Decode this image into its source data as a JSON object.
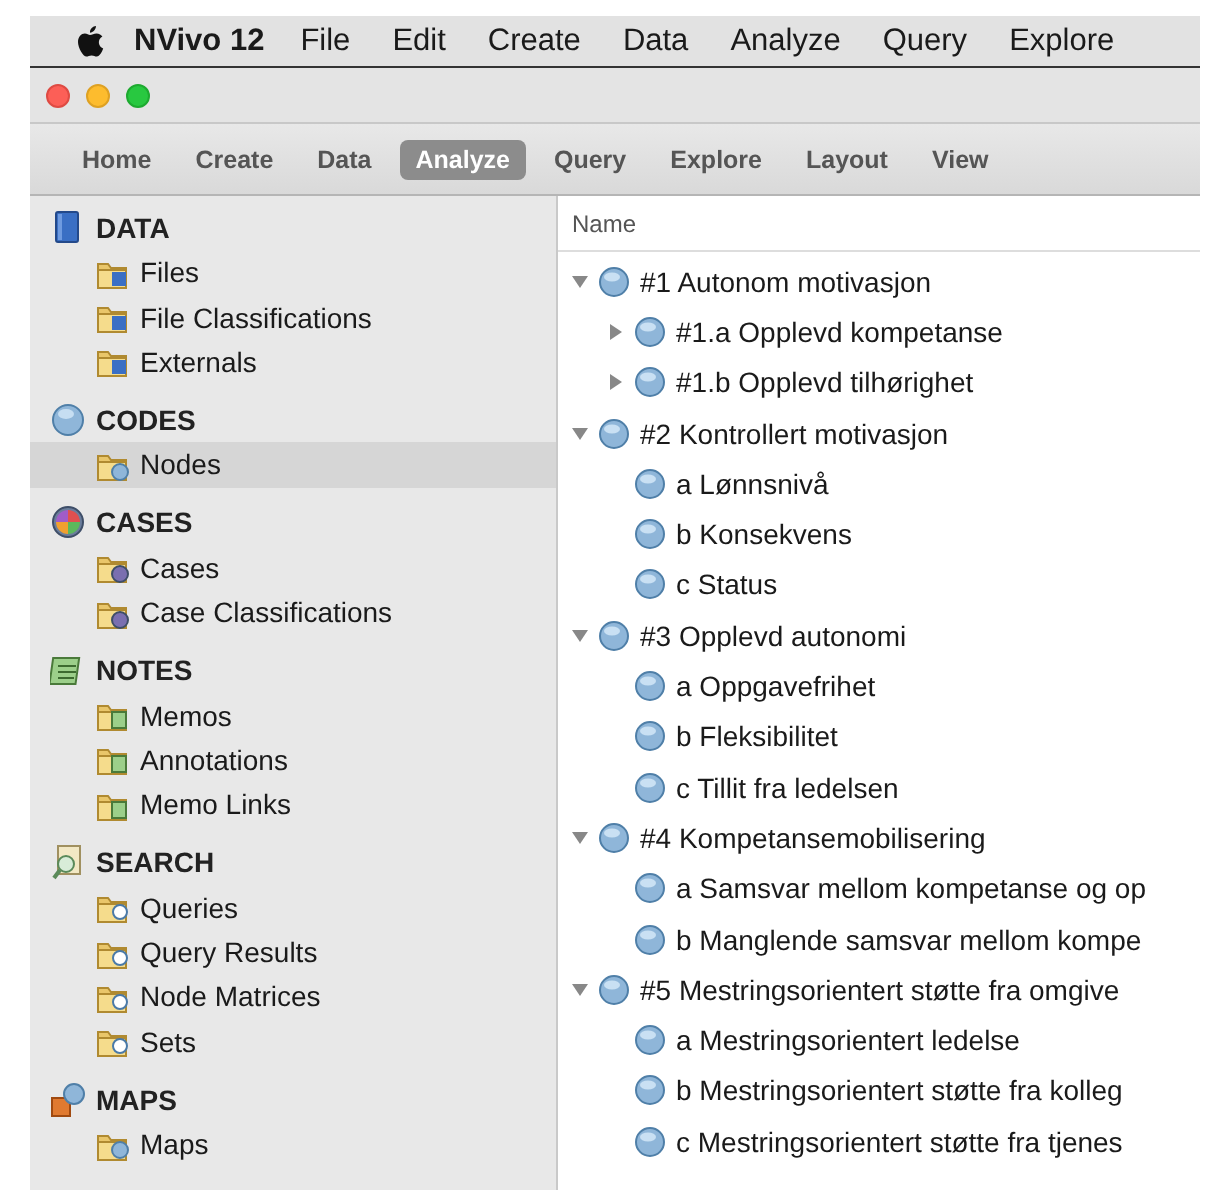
{
  "menu_bar": {
    "app_name": "NVivo 12",
    "menus": [
      "File",
      "Edit",
      "Create",
      "Data",
      "Analyze",
      "Query",
      "Explore"
    ]
  },
  "toolbar": {
    "tabs": [
      {
        "label": "Home",
        "selected": false
      },
      {
        "label": "Create",
        "selected": false
      },
      {
        "label": "Data",
        "selected": false
      },
      {
        "label": "Analyze",
        "selected": true
      },
      {
        "label": "Query",
        "selected": false
      },
      {
        "label": "Explore",
        "selected": false
      },
      {
        "label": "Layout",
        "selected": false
      },
      {
        "label": "View",
        "selected": false
      }
    ]
  },
  "sidebar": {
    "sections": [
      {
        "kind": "data",
        "title": "DATA",
        "items": [
          {
            "label": "Files",
            "selected": false
          },
          {
            "label": "File Classifications",
            "selected": false
          },
          {
            "label": "Externals",
            "selected": false
          }
        ]
      },
      {
        "kind": "codes",
        "title": "CODES",
        "items": [
          {
            "label": "Nodes",
            "selected": true
          }
        ]
      },
      {
        "kind": "cases",
        "title": "CASES",
        "items": [
          {
            "label": "Cases",
            "selected": false
          },
          {
            "label": "Case Classifications",
            "selected": false
          }
        ]
      },
      {
        "kind": "notes",
        "title": "NOTES",
        "items": [
          {
            "label": "Memos",
            "selected": false
          },
          {
            "label": "Annotations",
            "selected": false
          },
          {
            "label": "Memo Links",
            "selected": false
          }
        ]
      },
      {
        "kind": "search",
        "title": "SEARCH",
        "items": [
          {
            "label": "Queries",
            "selected": false
          },
          {
            "label": "Query Results",
            "selected": false
          },
          {
            "label": "Node Matrices",
            "selected": false
          },
          {
            "label": "Sets",
            "selected": false
          }
        ]
      },
      {
        "kind": "maps",
        "title": "MAPS",
        "items": [
          {
            "label": "Maps",
            "selected": false
          }
        ]
      }
    ]
  },
  "node_list": {
    "columns": [
      "Name"
    ],
    "nodes": [
      {
        "name": "#1 Autonom motivasjon",
        "expanded": true,
        "children": [
          {
            "name": "#1.a Opplevd kompetanse",
            "expanded": false
          },
          {
            "name": "#1.b Opplevd tilhørighet",
            "expanded": false
          }
        ]
      },
      {
        "name": "#2 Kontrollert motivasjon",
        "expanded": true,
        "children": [
          {
            "name": "a Lønnsnivå"
          },
          {
            "name": "b Konsekvens"
          },
          {
            "name": "c Status"
          }
        ]
      },
      {
        "name": "#3 Opplevd autonomi",
        "expanded": true,
        "children": [
          {
            "name": "a Oppgavefrihet"
          },
          {
            "name": "b Fleksibilitet"
          },
          {
            "name": "c Tillit fra ledelsen"
          }
        ]
      },
      {
        "name": "#4 Kompetansemobilisering",
        "expanded": true,
        "children": [
          {
            "name": "a Samsvar mellom kompetanse og op"
          },
          {
            "name": "b Manglende samsvar mellom kompe"
          }
        ]
      },
      {
        "name": "#5 Mestringsorientert støtte fra omgive",
        "expanded": true,
        "children": [
          {
            "name": "a Mestringsorientert ledelse"
          },
          {
            "name": "b Mestringsorientert støtte fra kolleg"
          },
          {
            "name": "c Mestringsorientert støtte fra tjenes"
          }
        ]
      }
    ]
  }
}
